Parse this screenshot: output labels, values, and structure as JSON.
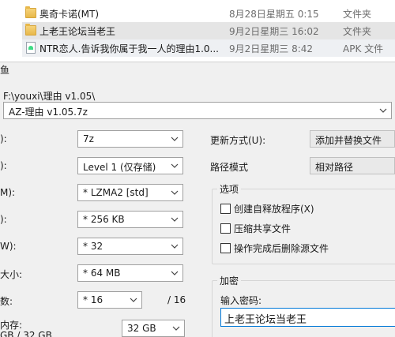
{
  "explorer": {
    "files": [
      {
        "name": "奥奇卡诺(MT)",
        "date": "8月28日星期五 0:15",
        "type": "文件夹",
        "icon": "folder-icon"
      },
      {
        "name": "上老王论坛当老王",
        "date": "9月2日星期三 16:02",
        "type": "文件夹",
        "icon": "folder-icon"
      },
      {
        "name": "NTR恋人.告诉我你属于我一人的理由1.0...",
        "date": "9月2日星期三 8:42",
        "type": "APK 文件",
        "icon": "apk-file-icon"
      }
    ]
  },
  "dialog": {
    "title_fragment": "鱼",
    "archive_path": "F:\\youxi\\理由 v1.05\\",
    "archive_name": "AZ-理由 v1.05.7z",
    "left": {
      "format": {
        "label": "):",
        "value": "7z"
      },
      "level": {
        "label": "):",
        "value": "Level 1 (仅存储)"
      },
      "method": {
        "label": "M):",
        "value": "* LZMA2 [std]"
      },
      "dictionary": {
        "label": "):",
        "value": "* 256 KB"
      },
      "word_size": {
        "label": "W):",
        "value": "* 32"
      },
      "solid_block": {
        "label": "大小:",
        "value": "* 64 MB"
      },
      "threads": {
        "label": "数:",
        "value": "* 16",
        "max": "/ 16"
      },
      "memory": {
        "label": "内存:",
        "usage": "GB / 32 GB",
        "value": "32 GB"
      }
    },
    "right": {
      "update_mode": {
        "label": "更新方式(U):",
        "value": "添加并替换文件"
      },
      "path_mode": {
        "label": "路径模式",
        "value": "相对路径"
      },
      "options": {
        "title": "选项",
        "items": [
          "创建自释放程序(X)",
          "压缩共享文件",
          "操作完成后删除源文件"
        ]
      },
      "encryption": {
        "title": "加密",
        "password_label": "输入密码:",
        "password_value": "上老王论坛当老王"
      }
    }
  }
}
